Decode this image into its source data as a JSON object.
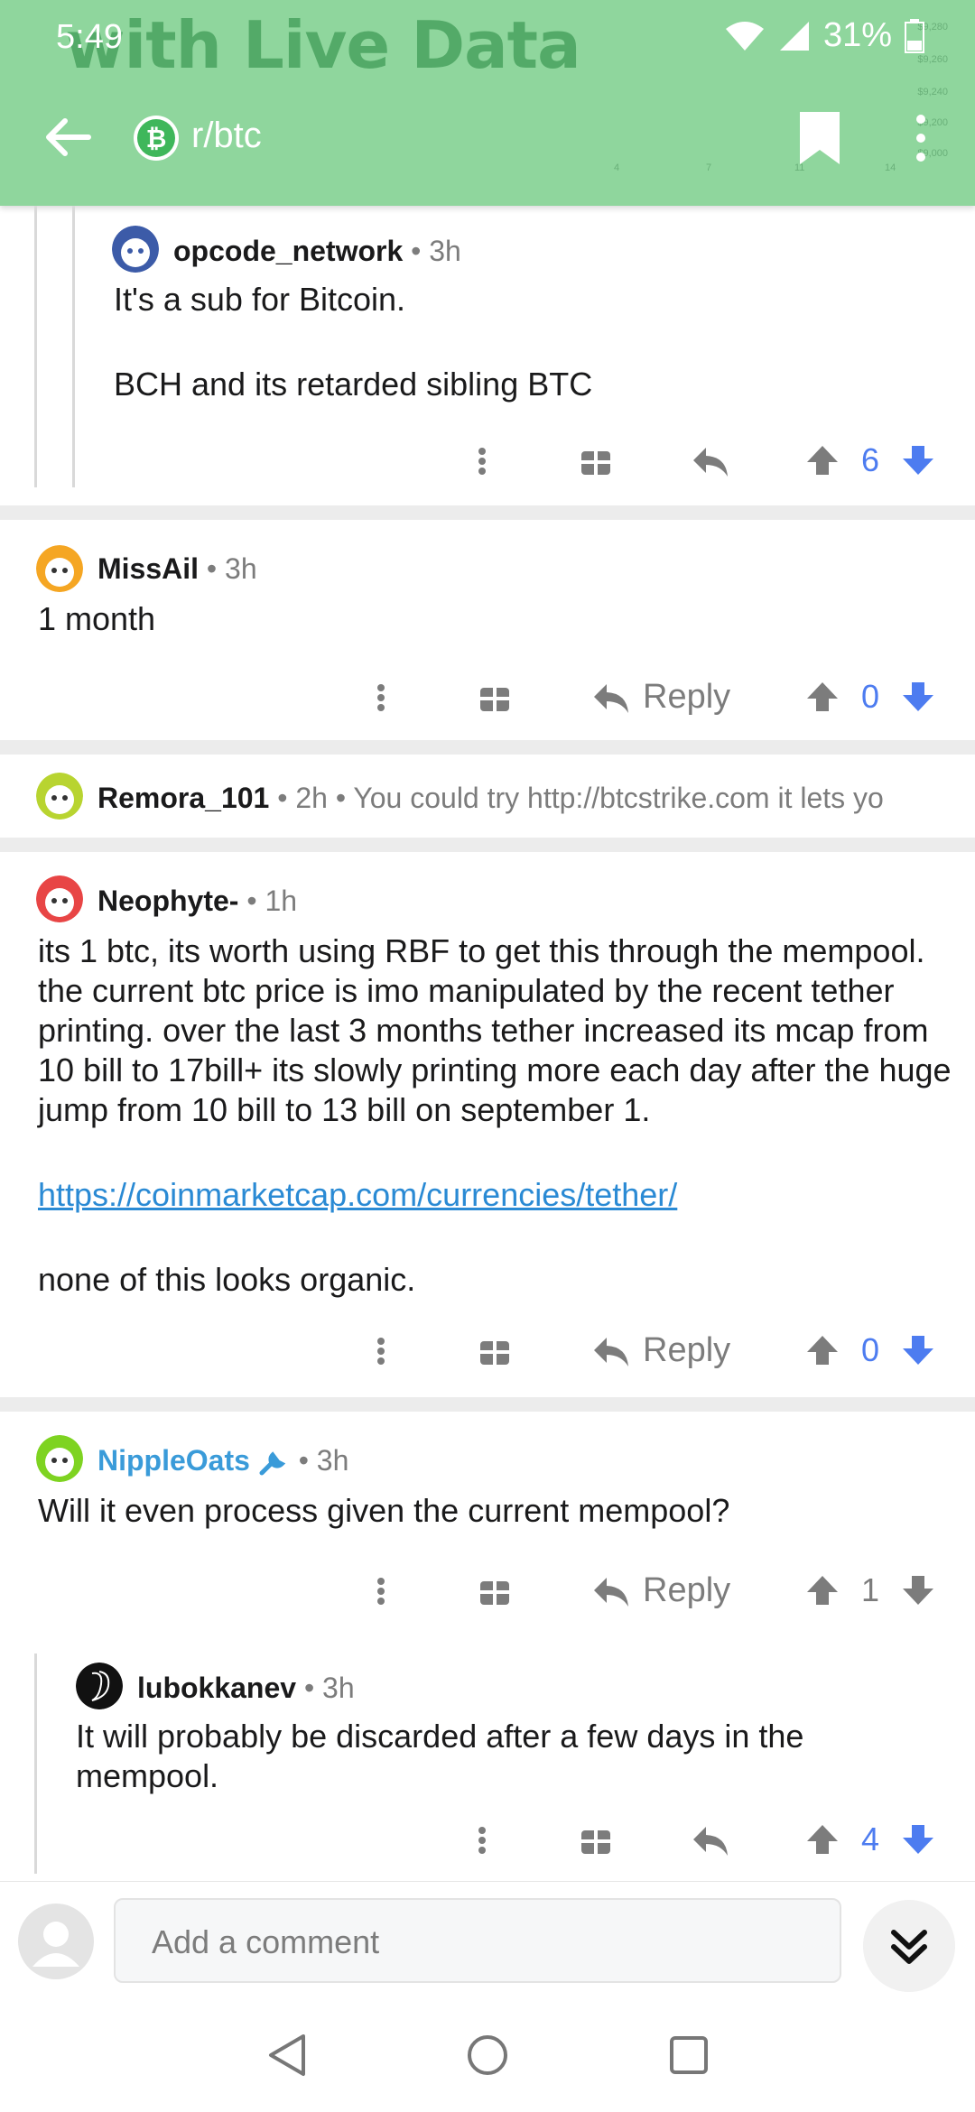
{
  "status_bar": {
    "time": "5:49",
    "battery": "31%"
  },
  "header": {
    "hero_title": "with Live Data",
    "chart_price_ticks": [
      "$9,280",
      "$9,260",
      "$9,240",
      "$9,200",
      "$9,000"
    ],
    "chart_date_ticks": [
      "4",
      "7",
      "11",
      "14"
    ],
    "subreddit": "r/btc",
    "accent": "#8fd69d"
  },
  "comments": [
    {
      "author": "opcode_network",
      "time": "3h",
      "paragraphs": [
        "It's a sub for Bitcoin.",
        "BCH and its retarded sibling BTC"
      ],
      "score": "6",
      "show_reply_label": false
    },
    {
      "author": "MissAil",
      "time": "3h",
      "paragraphs": [
        "1 month"
      ],
      "reply_label": "Reply",
      "score": "0"
    },
    {
      "author": "Remora_101",
      "time": "2h",
      "preview": "You could try http://btcstrike.com it lets yo"
    },
    {
      "author": "Neophyte-",
      "time": "1h",
      "paragraphs": [
        "its 1 btc, its worth using RBF to get this through the mempool. the current btc price is imo manipulated by the recent tether printing. over the last 3 months tether increased its mcap from 10 bill to 17bill+ its slowly printing more each day after the huge jump from 10 bill to 13 bill on september 1.",
        "none of this looks organic."
      ],
      "link": "https://coinmarketcap.com/currencies/tether/",
      "reply_label": "Reply",
      "score": "0"
    },
    {
      "author": "NippleOats",
      "time": "3h",
      "paragraphs": [
        "Will it even process given the current mempool?"
      ],
      "reply_label": "Reply",
      "score": "1"
    },
    {
      "author": "lubokkanev",
      "time": "3h",
      "paragraphs": [
        "It will probably be discarded after a few days in the mempool."
      ],
      "score": "4"
    }
  ],
  "comment_bar": {
    "placeholder": "Add a comment"
  },
  "colors": {
    "upvoted": "#4d7cf0",
    "mod_name": "#3a9bd9",
    "link": "#2a8ad4"
  }
}
